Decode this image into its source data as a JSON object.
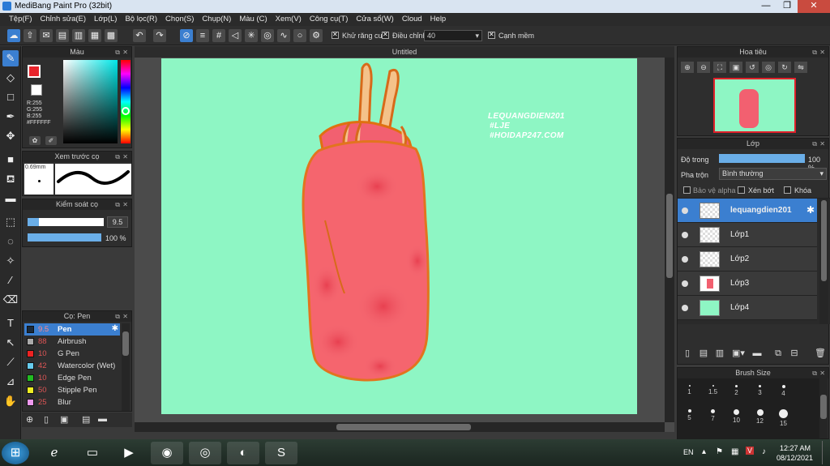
{
  "window": {
    "title": "MediBang Paint Pro (32bit)",
    "minimize": "—",
    "maximize": "❐",
    "close": "✕"
  },
  "menu": [
    "Tệp(F)",
    "Chỉnh sửa(E)",
    "Lớp(L)",
    "Bộ lọc(R)",
    "Chọn(S)",
    "Chụp(N)",
    "Màu (C)",
    "Xem(V)",
    "Công cụ(T)",
    "Cửa sổ(W)",
    "Cloud",
    "Help"
  ],
  "toolbar": {
    "antialias_label": "Khử răng cưa",
    "adjust_label": "Điều chỉnh",
    "adjust_value": "40",
    "snap_label": "Cạnh mềm"
  },
  "color_panel": {
    "title": "Màu",
    "r": "R:255",
    "g": "G:255",
    "b": "B:255",
    "hex": "#FFFFFF",
    "colors": {
      "primary": "#e8242c",
      "hue_marker": "#00ffff"
    }
  },
  "brush_preview": {
    "title": "Xem trước cọ",
    "size": "0.69mm"
  },
  "brush_control": {
    "title": "Kiểm soát cọ",
    "size_value": "9.5",
    "opacity_value": "100 %"
  },
  "brush_panel": {
    "title": "Cọ: Pen",
    "items": [
      {
        "size": "9.5",
        "name": "Pen",
        "color": "#1b2a3a"
      },
      {
        "size": "88",
        "name": "Airbrush",
        "color": "#aaaaaa"
      },
      {
        "size": "10",
        "name": "G Pen",
        "color": "#ee2222"
      },
      {
        "size": "42",
        "name": "Watercolor (Wet)",
        "color": "#66ccee"
      },
      {
        "size": "10",
        "name": "Edge Pen",
        "color": "#22bb22"
      },
      {
        "size": "50",
        "name": "Stipple Pen",
        "color": "#eeee22"
      },
      {
        "size": "25",
        "name": "Blur",
        "color": "#ee99ee"
      }
    ]
  },
  "canvas": {
    "tab": "Untitled",
    "bg_color": "#8ef6c4",
    "watermark": [
      "LEQUANGDIEN201",
      "#LJE",
      "#HOIDAP247.COM"
    ]
  },
  "navigator": {
    "title": "Hoa tiêu"
  },
  "layer_panel": {
    "title": "Lớp",
    "opacity_label": "Độ trong",
    "opacity_value": "100 %",
    "blend_label": "Pha trộn",
    "blend_value": "Bình thường",
    "protect_alpha": "Bảo vệ alpha",
    "clipping": "Xén bớt",
    "lock": "Khóa",
    "layers": [
      {
        "name": "lequangdien201"
      },
      {
        "name": "Lớp1"
      },
      {
        "name": "Lớp2"
      },
      {
        "name": "Lớp3"
      },
      {
        "name": "Lớp4"
      }
    ]
  },
  "brush_size": {
    "title": "Brush Size",
    "sizes": [
      "1",
      "1.5",
      "2",
      "3",
      "4",
      "5",
      "7",
      "10",
      "12",
      "15"
    ]
  },
  "taskbar": {
    "lang": "EN",
    "time": "12:27 AM",
    "date": "08/12/2021"
  }
}
